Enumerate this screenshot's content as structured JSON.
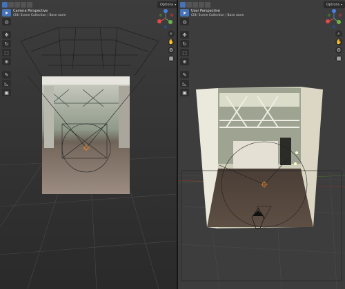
{
  "left_viewport": {
    "title": "Camera Perspective",
    "subtitle": "(28) Scene Collection | Base room",
    "options_label": "Options"
  },
  "right_viewport": {
    "title": "User Perspective",
    "subtitle": "(28) Scene Collection | Base room",
    "options_label": "Options"
  },
  "toolbar_tools": [
    {
      "icon": "select-cursor-icon",
      "glyph": "➤",
      "active": true
    },
    {
      "icon": "cursor-3d-icon",
      "glyph": "◎",
      "active": false
    },
    {
      "icon": "move-icon",
      "glyph": "✥",
      "active": false
    },
    {
      "icon": "rotate-icon",
      "glyph": "↻",
      "active": false
    },
    {
      "icon": "scale-icon",
      "glyph": "⬚",
      "active": false
    },
    {
      "icon": "transform-icon",
      "glyph": "⊕",
      "active": false
    },
    {
      "icon": "annotate-icon",
      "glyph": "✎",
      "active": false
    },
    {
      "icon": "measure-icon",
      "glyph": "◺",
      "active": false
    },
    {
      "icon": "add-cube-icon",
      "glyph": "▣",
      "active": false
    }
  ],
  "nav_icons": [
    {
      "icon": "zoom-icon",
      "glyph": "⌕"
    },
    {
      "icon": "pan-hand-icon",
      "glyph": "✋"
    },
    {
      "icon": "camera-view-icon",
      "glyph": "⚙"
    },
    {
      "icon": "ortho-grid-icon",
      "glyph": "▦"
    }
  ],
  "colors": {
    "axis_x": "#e24a4a",
    "axis_y": "#6bb64a",
    "axis_z": "#4a7fe2",
    "accent": "#4772b3"
  }
}
